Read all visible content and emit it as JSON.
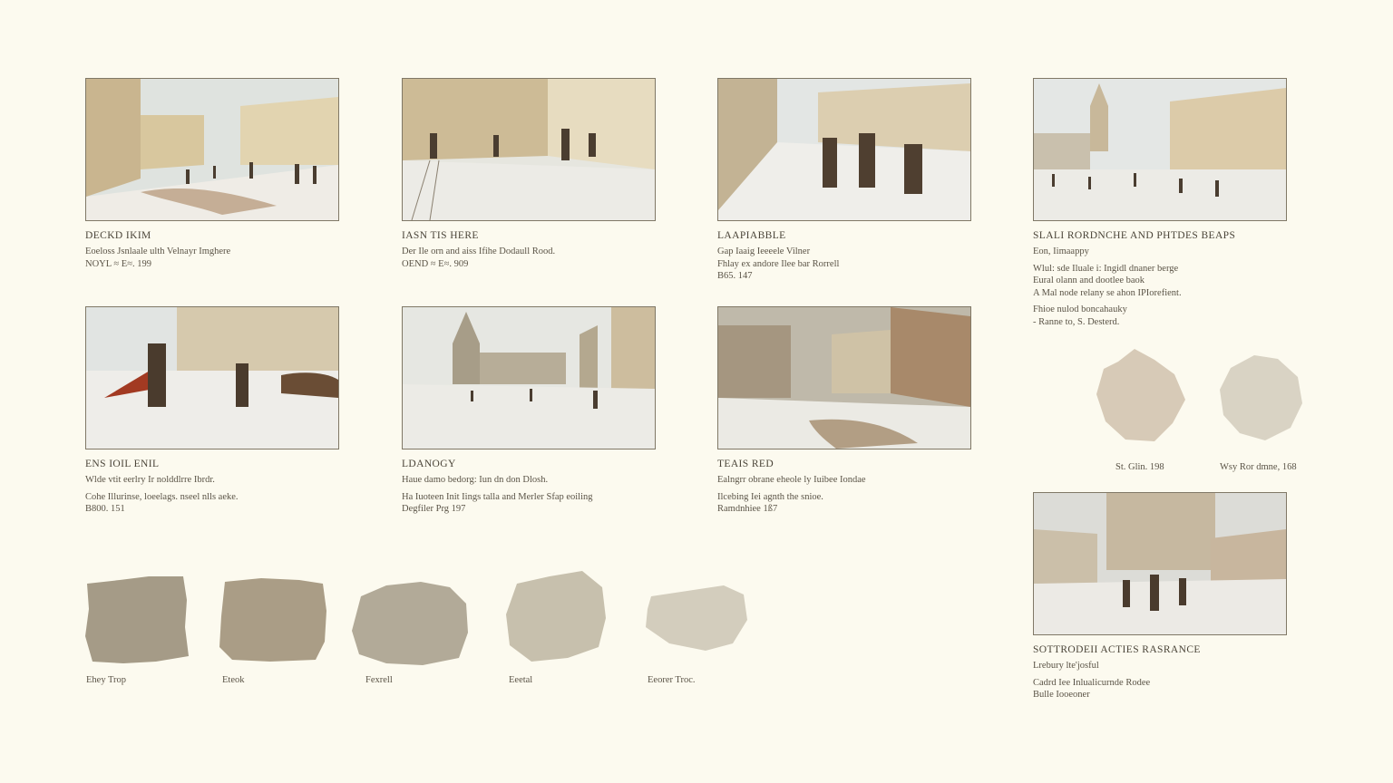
{
  "cards": [
    {
      "title": "DECKD IKIM",
      "lines": [
        "Eoeloss Jsnlaale ulth Velnayr Imghere",
        "NOYL ≈ E≈. 199"
      ]
    },
    {
      "title": "IASN TIS HERE",
      "lines": [
        "Der Ile orn and aiss Ifihe Dodaull Rood.",
        "OEND ≈ E≈. 909"
      ]
    },
    {
      "title": "LAAPIABBLE",
      "lines": [
        "Gap Iaaig Ieeeele Vilner",
        "Fhlay ex andore Ilee bar Rorrell",
        "B65. 147"
      ]
    },
    {
      "title": "SLALI RORDNCHE AND PHTDES BEAPS",
      "lines": [
        "Eon, Iimaappy",
        "Wlul: sde Iluale i: Ingidl dnaner berge",
        "Eural olann and dootlee baok",
        "A Mal node relany se ahon IPIorefient.",
        "Fhioe nulod boncahauky",
        "- Ranne to, S. Desterd."
      ]
    },
    {
      "title": "ENS IOIL ENIL",
      "lines": [
        "Wlde vtit eerlry Ir nolddlrre Ibrdr.",
        "Cohe Illurinse, loeelags. nseel nlls aeke.",
        "B800. 151"
      ]
    },
    {
      "title": "LDANOGY",
      "lines": [
        "Haue damo bedorg: Iun dn don Dlosh.",
        "Ha Iuoteen Init Iings talla and Merler Sfap eoiling",
        "Degfiler Prg 197"
      ]
    },
    {
      "title": "TEAIS RED",
      "lines": [
        "Ealngrr obrane eheole ly Iuibee Iondae",
        "Ilcebing Iei agnth the snioe.",
        "Ramdnhiee 1ß7"
      ]
    },
    {
      "title": "SOTTRODEII ACTIES RASRANCE",
      "lines": [
        "Lrebury lte'josful",
        "Cadrd Iee Inlualicurnde Rodee",
        "Bulle Iooeoner"
      ]
    }
  ],
  "swatches_bottom": [
    "Ehey Trop",
    "Eteok",
    "Fexrell",
    "Eeetal",
    "Eeorer Troc."
  ],
  "swatches_right": [
    "St. Glin. 198",
    "Wsy Ror dmne, 168"
  ],
  "colors": {
    "background": "#fcfaef",
    "swatch_1": "#a59b87",
    "swatch_2": "#aa9d86",
    "swatch_3": "#b2aa98",
    "swatch_4": "#c7c0ad",
    "swatch_5": "#d3cdbd",
    "swatch_6": "#d7cab7",
    "swatch_7": "#d9d3c4"
  }
}
